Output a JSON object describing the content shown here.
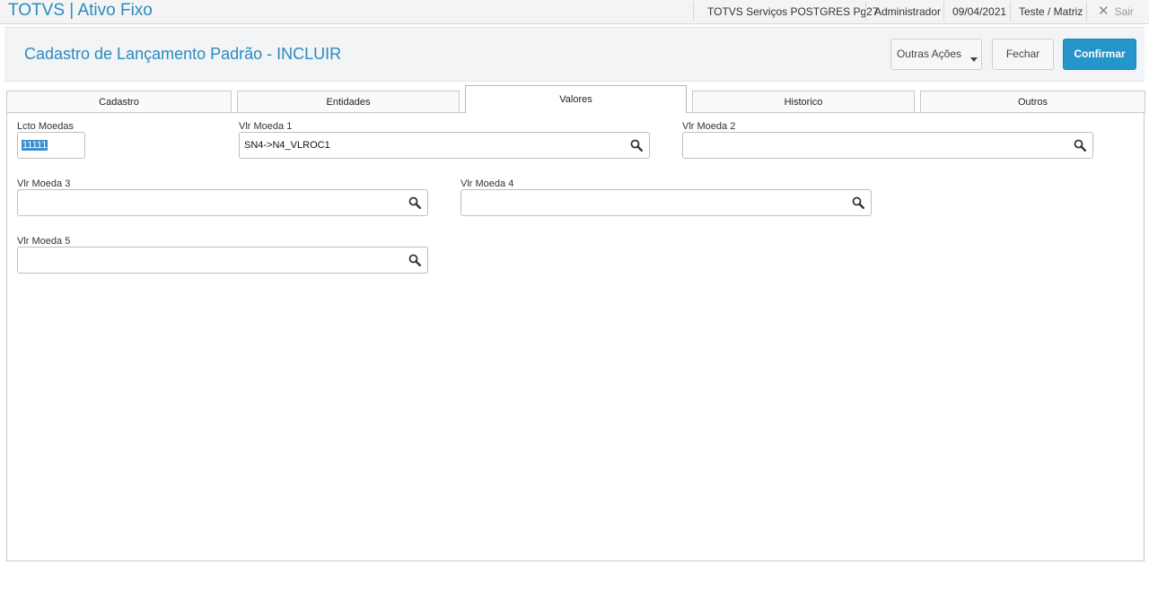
{
  "topbar": {
    "app_title": "TOTVS | Ativo Fixo",
    "environment": "TOTVS Serviços POSTGRES Pg27",
    "user": "Administrador",
    "date": "09/04/2021",
    "branch": "Teste / Matriz",
    "exit_label": "Sair"
  },
  "header": {
    "title": "Cadastro de Lançamento Padrão - INCLUIR",
    "more_actions_label": "Outras Ações",
    "close_label": "Fechar",
    "confirm_label": "Confirmar"
  },
  "tabs": [
    {
      "label": "Cadastro"
    },
    {
      "label": "Entidades"
    },
    {
      "label": "Valores",
      "active": true
    },
    {
      "label": "Historico"
    },
    {
      "label": "Outros"
    }
  ],
  "form": {
    "lcto_moedas": {
      "label": "Lcto Moedas",
      "value": "11111"
    },
    "vlr_moeda_1": {
      "label": "Vlr Moeda 1",
      "value": "SN4->N4_VLROC1"
    },
    "vlr_moeda_2": {
      "label": "Vlr Moeda 2",
      "value": ""
    },
    "vlr_moeda_3": {
      "label": "Vlr Moeda 3",
      "value": ""
    },
    "vlr_moeda_4": {
      "label": "Vlr Moeda 4",
      "value": ""
    },
    "vlr_moeda_5": {
      "label": "Vlr Moeda 5",
      "value": ""
    }
  },
  "colors": {
    "brand": "#2a8bbd",
    "primary_button": "#2596c9",
    "selection": "#3b8fd0"
  }
}
